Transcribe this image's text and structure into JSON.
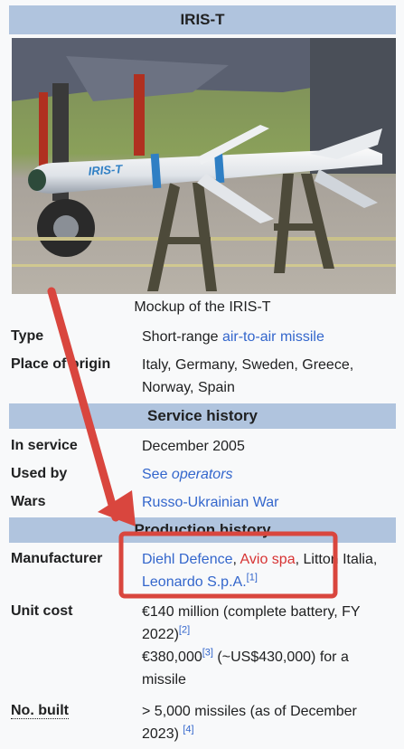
{
  "title": "IRIS-T",
  "caption": "Mockup of the IRIS-T",
  "photo_missile_marking": "IRIS-T",
  "rows": {
    "type": {
      "label": "Type",
      "text": "Short-range ",
      "link": "air-to-air missile"
    },
    "origin": {
      "label": "Place of origin",
      "text": "Italy, Germany, Sweden, Greece, Norway, Spain"
    }
  },
  "sections": {
    "service": "Service history",
    "production": "Production history"
  },
  "service": {
    "in_service": {
      "label": "In service",
      "value": "December 2005"
    },
    "used_by": {
      "label": "Used by",
      "see": "See ",
      "link": "operators"
    },
    "wars": {
      "label": "Wars",
      "link": "Russo-Ukrainian War"
    }
  },
  "production": {
    "manufacturer": {
      "label": "Manufacturer",
      "m1": "Diehl Defence",
      "sep1": ", ",
      "m2": "Avio spa",
      "sep2": ", Litton Italia, ",
      "m4": "Leonardo S.p.A.",
      "ref": "[1]"
    },
    "unit_cost": {
      "label": "Unit cost",
      "line1": "€140 million (complete battery, FY 2022)",
      "ref1": "[2]",
      "line2a": "€380,000",
      "ref2": "[3]",
      "line2b": " (~US$430,000) for a missile"
    },
    "no_built": {
      "label": "No. built",
      "text": "> 5,000 missiles (as of December 2023) ",
      "ref": "[4]"
    }
  },
  "annotation_color": "#d9463e"
}
